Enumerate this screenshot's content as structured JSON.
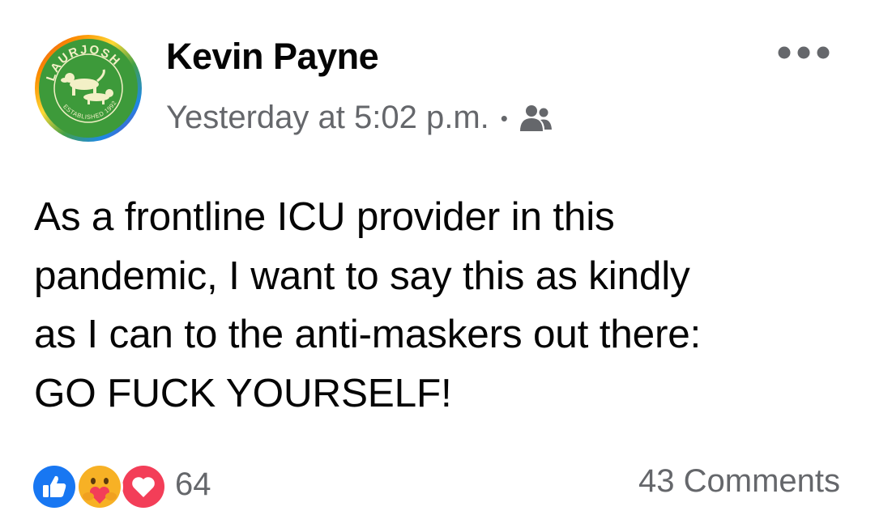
{
  "post": {
    "avatar": {
      "ring_text": "LAURJOSH",
      "established_text": "ESTABLISHED 1992",
      "icon": "dachshund-logo-icon"
    },
    "author": "Kevin Payne",
    "timestamp": "Yesterday at 5:02 p.m.",
    "separator": "•",
    "audience_icon": "friends-icon",
    "more_icon": "more-options-icon",
    "body_lines": [
      "As a frontline ICU provider in this",
      "pandemic, I want to say this as kindly",
      "as I can to the anti-maskers out there:",
      "GO FUCK YOURSELF!"
    ]
  },
  "footer": {
    "reaction_icons": [
      "like-icon",
      "care-icon",
      "love-icon"
    ],
    "reaction_count": "64",
    "comments": "43 Comments"
  },
  "colors": {
    "like_blue": "#1877f2",
    "love_red": "#f33e58",
    "care_yellow": "#f7b125",
    "secondary_text": "#65676b",
    "logo_green": "#3d9a3a",
    "logo_cream": "#f3f0c6"
  }
}
